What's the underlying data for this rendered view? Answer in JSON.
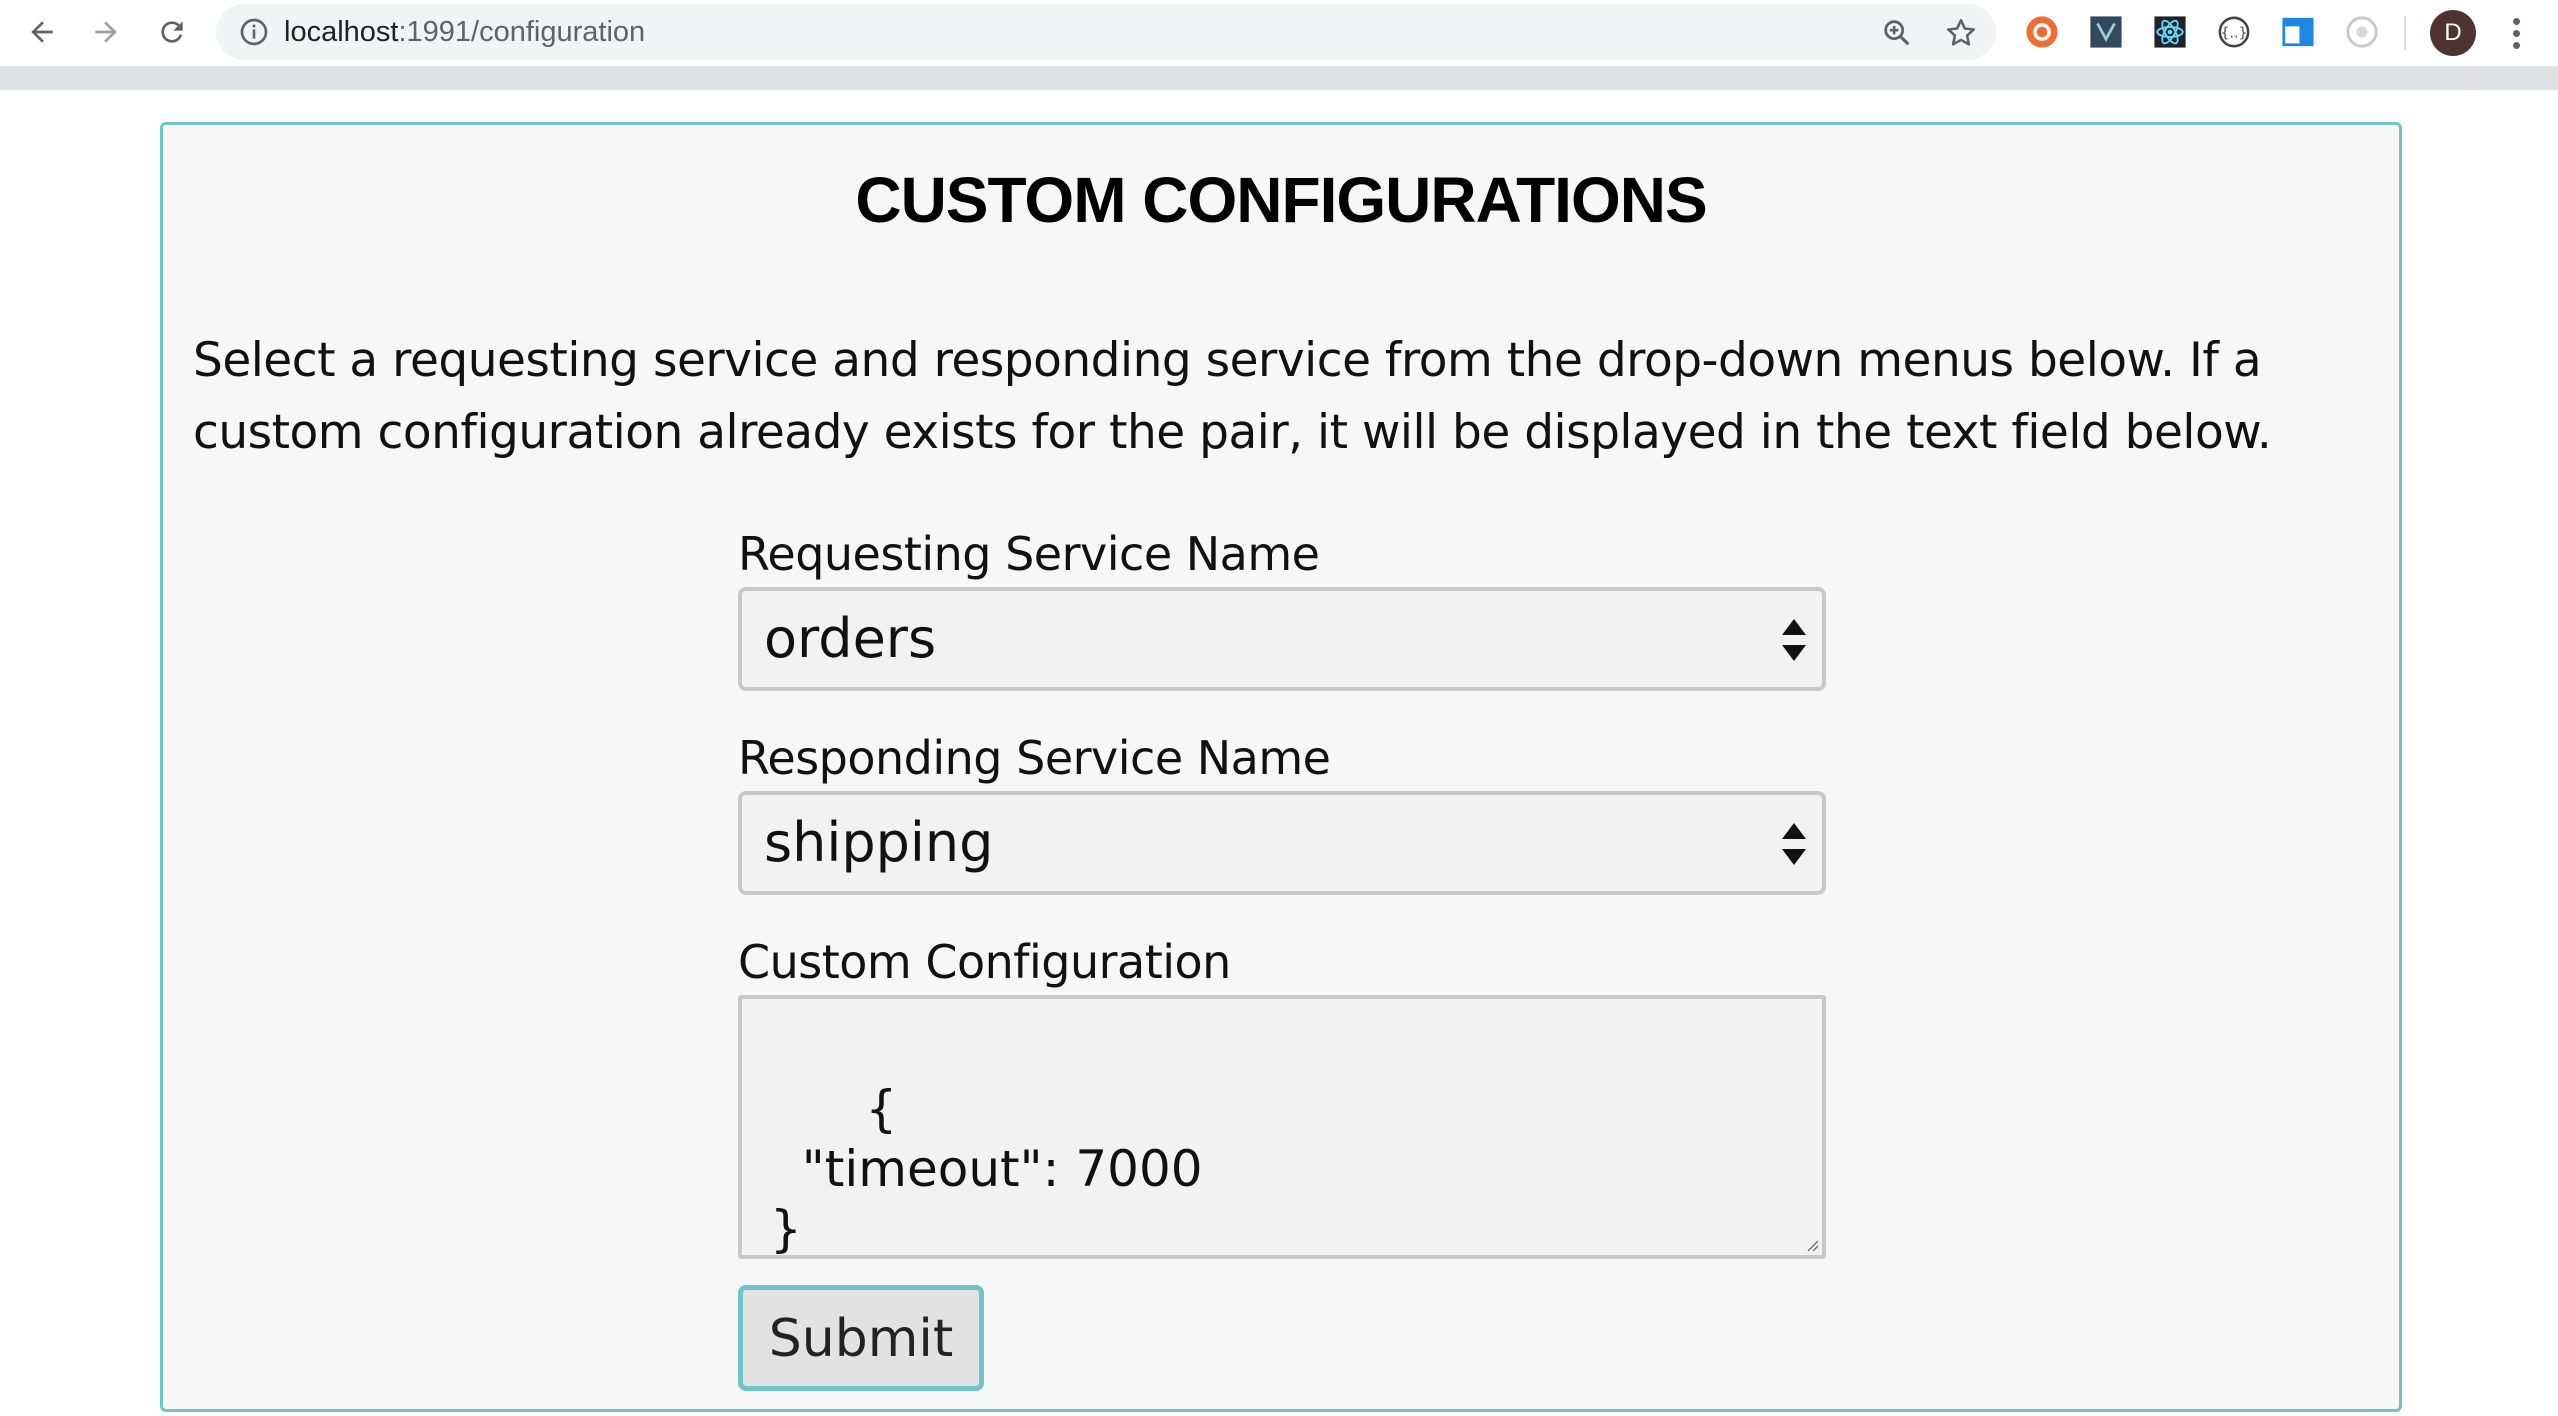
{
  "browser": {
    "url_host": "localhost",
    "url_path": ":1991/configuration",
    "avatar_letter": "D"
  },
  "page": {
    "title": "CUSTOM CONFIGURATIONS",
    "intro": "Select a requesting service and responding service from the drop-down menus below. If a custom configuration already exists for the pair, it will be displayed in the text field below."
  },
  "form": {
    "requesting_label": "Requesting Service Name",
    "requesting_value": "orders",
    "responding_label": "Responding Service Name",
    "responding_value": "shipping",
    "config_label": "Custom Configuration",
    "config_value": "{\n  \"timeout\": 7000\n}",
    "submit_label": "Submit"
  },
  "colors": {
    "accent": "#6ec4c8",
    "card_bg": "#f7f7f7"
  },
  "icons": {
    "back": "arrow-left-icon",
    "forward": "arrow-right-icon",
    "reload": "reload-icon",
    "info": "info-icon",
    "zoom": "zoom-icon",
    "star": "star-icon"
  }
}
